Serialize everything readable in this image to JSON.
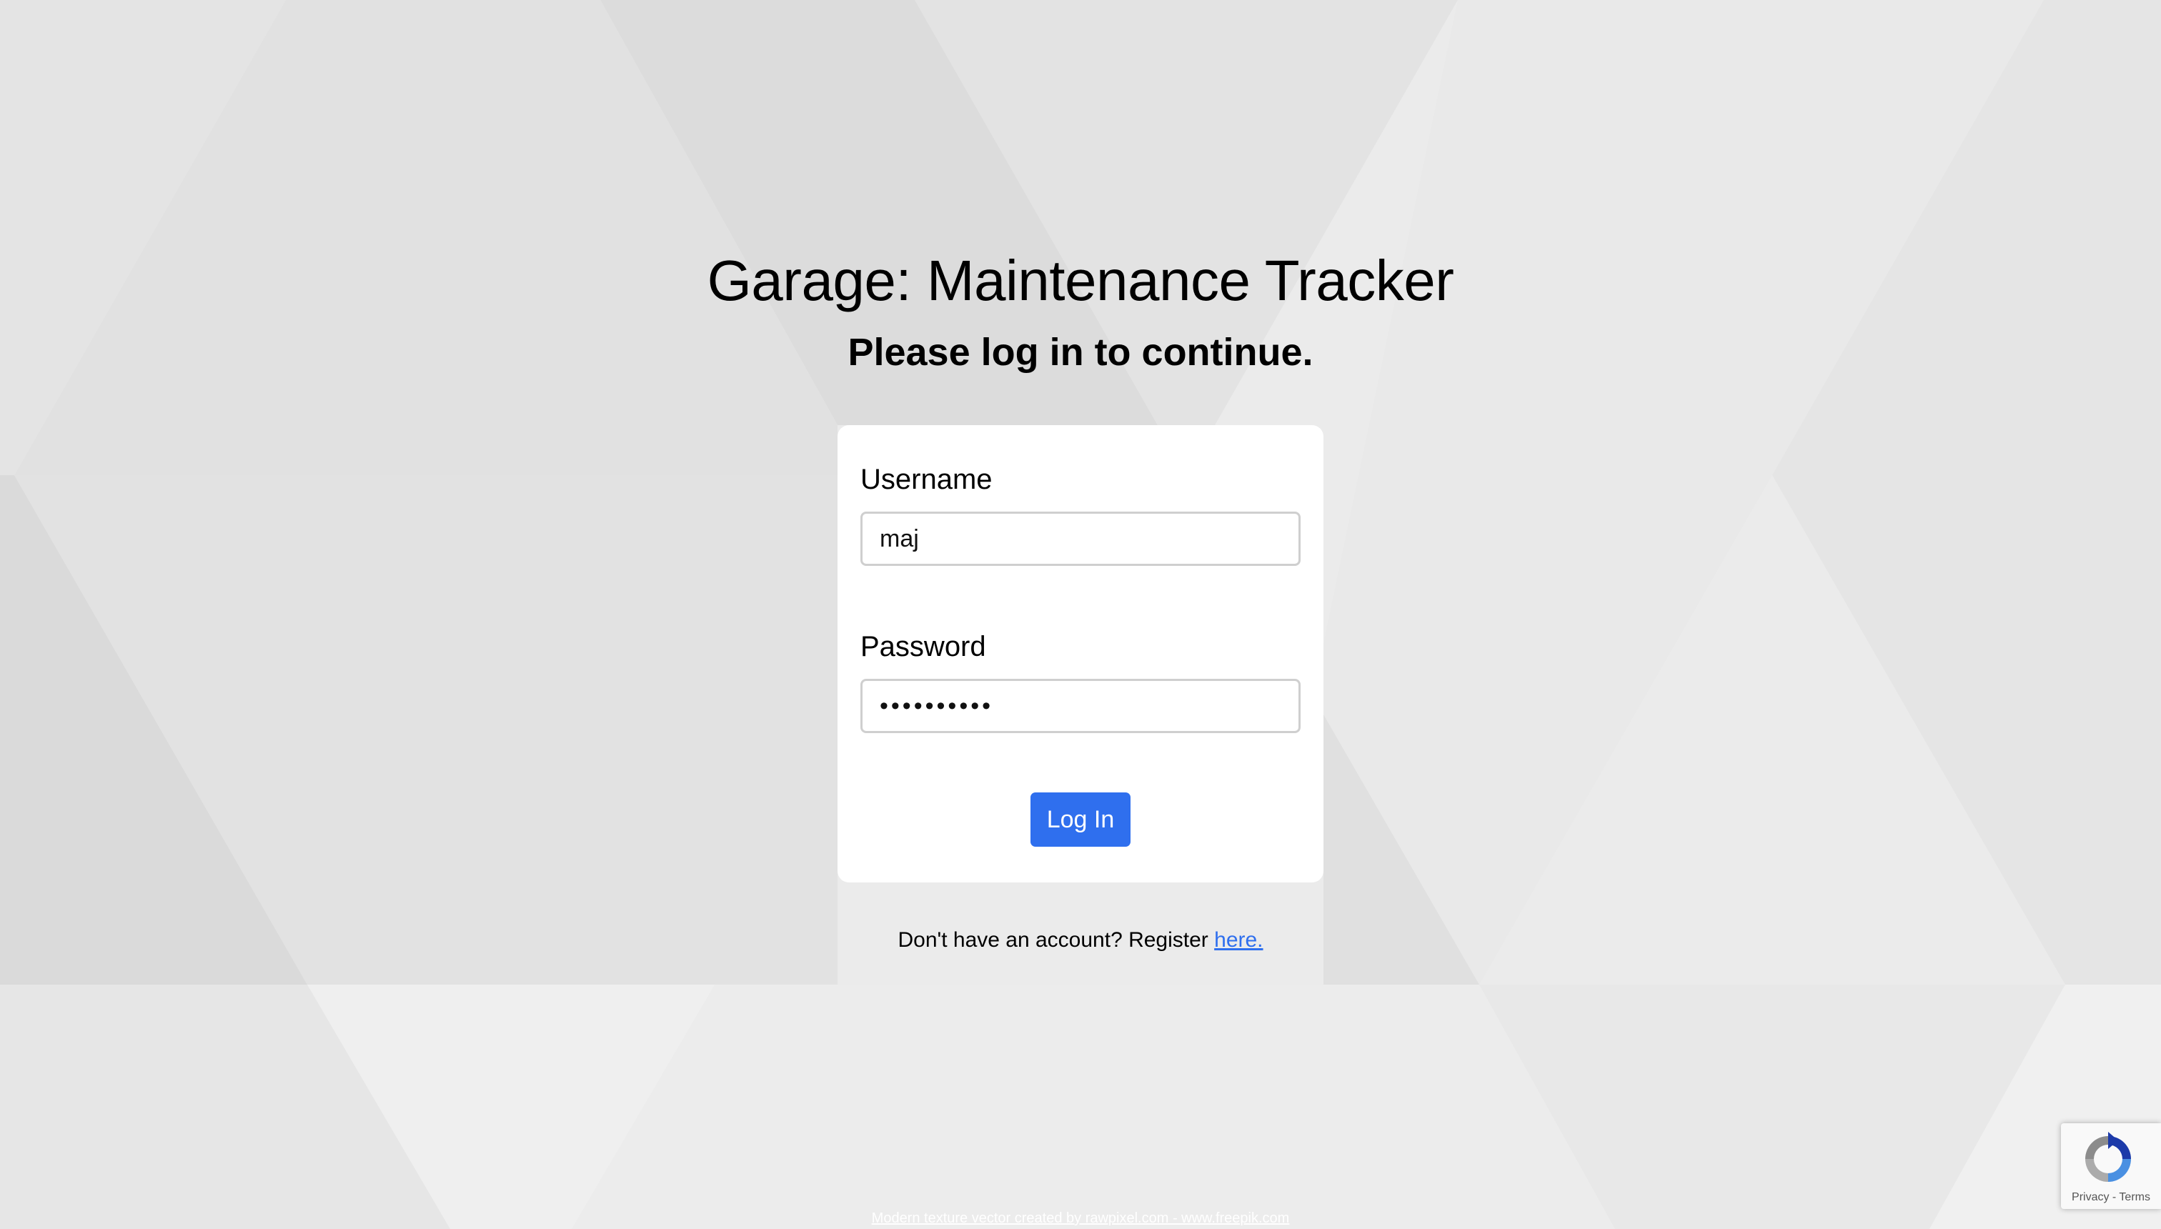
{
  "page": {
    "title": "Garage: Maintenance Tracker",
    "subtitle": "Please log in to continue."
  },
  "login_form": {
    "username_label": "Username",
    "username_value": "maj",
    "password_label": "Password",
    "password_value": "••••••••••",
    "submit_label": "Log In"
  },
  "register": {
    "prompt": "Don't have an account? Register ",
    "link_text": "here."
  },
  "footer": {
    "attribution": "Modern texture vector created by rawpixel.com - www.freepik.com"
  },
  "recaptcha": {
    "terms_text": "Privacy - Terms",
    "icon": "recaptcha-icon"
  },
  "colors": {
    "accent": "#2f6fee",
    "background": "#e9e9e9",
    "card": "#ffffff"
  }
}
